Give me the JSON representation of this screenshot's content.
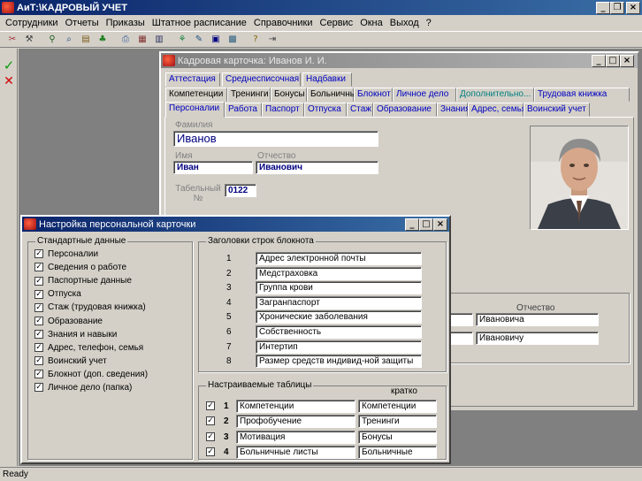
{
  "app": {
    "title": "АиТ:\\КАДРОВЫЙ УЧЕТ"
  },
  "menu": [
    "Сотрудники",
    "Отчеты",
    "Приказы",
    "Штатное расписание",
    "Справочники",
    "Сервис",
    "Окна",
    "Выход",
    "?"
  ],
  "toolbar_icons": [
    "scissors-icon",
    "tools-icon",
    "binoculars-icon",
    "find-icon",
    "clipboard-icon",
    "tree-icon",
    "print-icon",
    "grid-icon",
    "table-icon",
    "funnel-icon",
    "edit-icon",
    "list-icon",
    "save-icon",
    "help-icon",
    "exit-icon"
  ],
  "side": {
    "apply": "✓",
    "cancel": "✕"
  },
  "card": {
    "title": "Кадровая карточка: Иванов И. И.",
    "tabs_row1": [
      "Аттестация",
      "Среднесписочная",
      "Надбавки"
    ],
    "tabs_row2": [
      "Компетенции",
      "Тренинги",
      "Бонусы",
      "Больничные",
      "Блокнот",
      "Личное дело",
      "Дополнительно...",
      "Трудовая книжка"
    ],
    "tabs_row3": [
      "Персоналии",
      "Работа",
      "Паспорт",
      "Отпуска",
      "Стаж",
      "Образование",
      "Знания",
      "Адрес, семья",
      "Воинский учет"
    ],
    "labels": {
      "surname": "Фамилия",
      "name": "Имя",
      "patronymic": "Отчество",
      "tabnum": "Табельный №",
      "patronymic2": "Отчество"
    },
    "values": {
      "surname": "Иванов",
      "name": "Иван",
      "patronymic": "Иванович",
      "tabnum": "0122",
      "pat_gen": "Ивановича",
      "pat_acc": "Ивановичу"
    }
  },
  "dialog": {
    "title": "Настройка персональной карточки",
    "standard_group": "Стандартные данные",
    "standard": [
      "Персоналии",
      "Сведения о работе",
      "Паспортные данные",
      "Отпуска",
      "Стаж (трудовая книжка)",
      "Образование",
      "Знания и навыки",
      "Адрес, телефон, семья",
      "Воинский учет",
      "Блокнот (доп. сведения)",
      "Личное дело (папка)"
    ],
    "notebook_group": "Заголовки строк блокнота",
    "notebook": [
      {
        "n": "1",
        "text": "Адрес электронной почты"
      },
      {
        "n": "2",
        "text": "Медстраховка"
      },
      {
        "n": "3",
        "text": "Группа крови"
      },
      {
        "n": "4",
        "text": "Загранпаспорт"
      },
      {
        "n": "5",
        "text": "Хронические заболевания"
      },
      {
        "n": "6",
        "text": "Собственность"
      },
      {
        "n": "7",
        "text": "Интертип"
      },
      {
        "n": "8",
        "text": "Размер средств индивид-ной защиты"
      }
    ],
    "tables_group": "Настраиваемые таблицы",
    "short_header": "кратко",
    "tables": [
      {
        "n": "1",
        "full": "Компетенции",
        "short": "Компетенции"
      },
      {
        "n": "2",
        "full": "Профобучение",
        "short": "Тренинги"
      },
      {
        "n": "3",
        "full": "Мотивация",
        "short": "Бонусы"
      },
      {
        "n": "4",
        "full": "Больничные листы",
        "short": "Больничные"
      }
    ]
  },
  "status": {
    "text": "Ready"
  }
}
